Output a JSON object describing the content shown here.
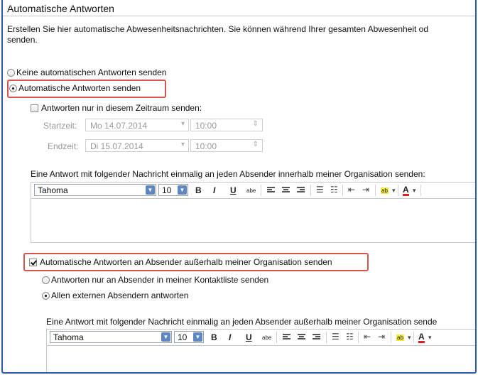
{
  "dialog": {
    "title": "Automatische Antworten",
    "intro_line1": "Erstellen Sie hier automatische Abwesenheitsnachrichten. Sie können während Ihrer gesamten Abwesenheit od",
    "intro_line2": "senden."
  },
  "internal": {
    "option_off": "Keine automatischen Antworten senden",
    "option_on": "Automatische Antworten senden",
    "period_checkbox": "Antworten nur in diesem Zeitraum senden:",
    "start_label": "Startzeit:",
    "start_date": "Mo 14.07.2014",
    "start_time": "10:00",
    "end_label": "Endzeit:",
    "end_date": "Di 15.07.2014",
    "end_time": "10:00",
    "message_label": "Eine Antwort mit folgender Nachricht einmalig an jeden Absender innerhalb meiner Organisation senden:",
    "font": "Tahoma",
    "size": "10"
  },
  "external": {
    "checkbox": "Automatische Antworten an Absender außerhalb meiner Organisation senden",
    "option_contacts": "Antworten nur an Absender in meiner Kontaktliste senden",
    "option_all": "Allen externen Absendern antworten",
    "message_label": "Eine Antwort mit folgender Nachricht einmalig an jeden Absender außerhalb meiner Organisation sende",
    "font": "Tahoma",
    "size": "10"
  },
  "toolbar": {
    "bold": "B",
    "italic": "I",
    "underline": "U",
    "strike": "abe",
    "highlight": "ab",
    "font_color": "A"
  },
  "colors": {
    "frame": "#2a5aa8",
    "highlight_box": "#d9534f",
    "dropdown": "#5f86c4"
  }
}
